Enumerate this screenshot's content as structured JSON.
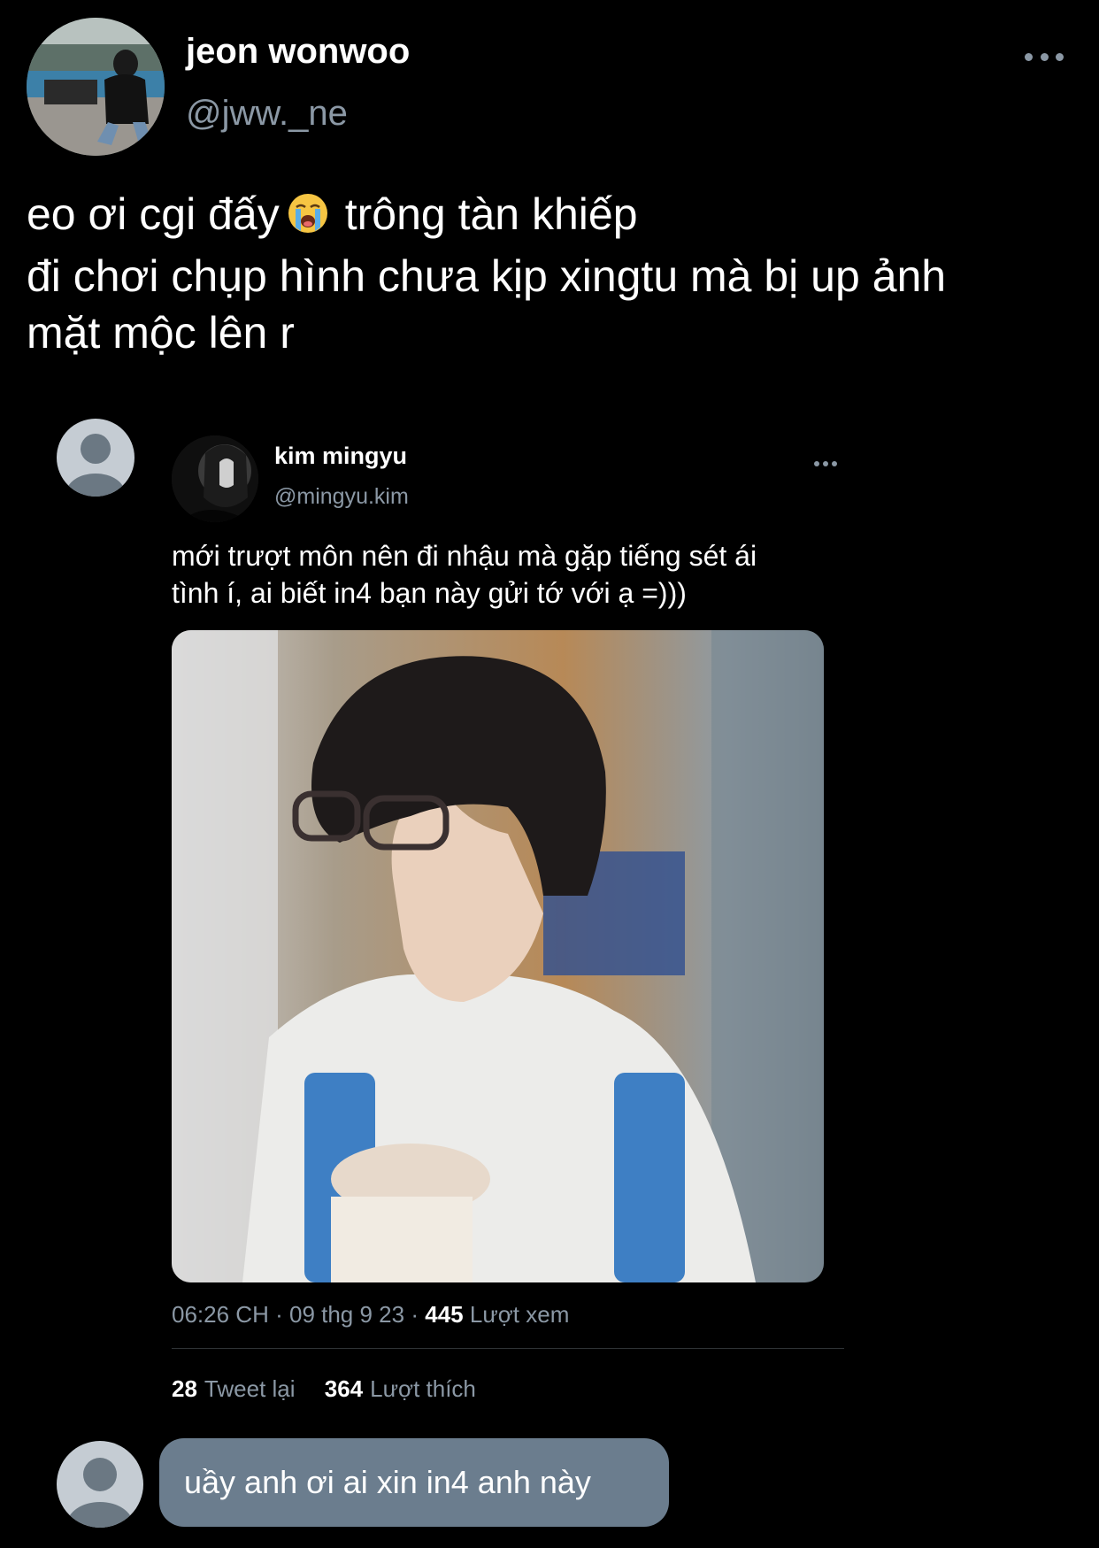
{
  "tweet": {
    "author_name": "jeon wonwoo",
    "author_handle": "@jww._ne",
    "text_line1_part1": "eo ơi cgi đấy",
    "text_line1_part2": "trông tàn khiếp",
    "text_line2": "đi chơi chụp hình chưa kịp xingtu mà bị up ảnh",
    "text_line3": "mặt mộc lên r",
    "emoji_icon": "loudly-crying-face-icon"
  },
  "quoted_tweet": {
    "author_name": "kim mingyu",
    "author_handle": "@mingyu.kim",
    "text_line1": "mới trượt môn nên đi nhậu mà gặp tiếng sét ái",
    "text_line2": "tình í, ai biết in4 bạn này gửi tớ với ạ =)))",
    "time": "06:26 CH",
    "separator": "·",
    "date": "09 thg 9 23",
    "views_count": "445",
    "views_label": "Lượt xem",
    "retweets_count": "28",
    "retweets_label": "Tweet lại",
    "likes_count": "364",
    "likes_label": "Lượt thích"
  },
  "reply": {
    "text": "uầy anh ơi ai xin in4 anh này"
  },
  "colors": {
    "background": "#000000",
    "primary_text": "#ffffff",
    "secondary_text": "#8b98a5",
    "divider": "#2f3336",
    "reply_bubble": "#6b7d8e",
    "default_avatar": "#c5ccd3"
  }
}
